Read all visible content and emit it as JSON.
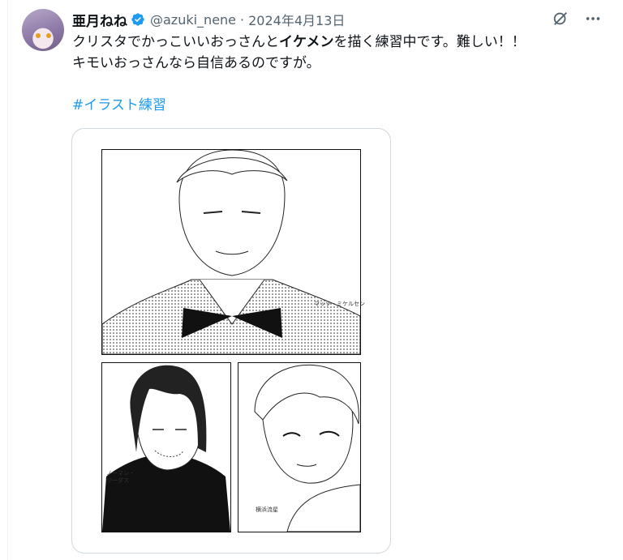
{
  "author": {
    "display_name": "亜月ねね",
    "handle": "@azuki_nene",
    "separator": "·",
    "date": "2024年4月13日"
  },
  "tweet": {
    "line1_pre": "クリスタでかっこいいおっさんと",
    "line1_bold": "イケメン",
    "line1_post": "を描く練習中です。難しい！！",
    "line2": "キモいおっさんなら自信あるのですが。",
    "hashtag": "#イラスト練習"
  },
  "illustration": {
    "panel1_caption": "マッツ・ミケルセン",
    "panel2_caption": "ノーマン・リーダス",
    "panel3_caption": "横浜流星"
  },
  "icons": {
    "verified": "verified-badge-icon",
    "grok": "grok-icon",
    "more": "more-icon"
  },
  "colors": {
    "accent": "#1d9bf0",
    "secondary_text": "#536471",
    "border": "#cfd9de"
  }
}
